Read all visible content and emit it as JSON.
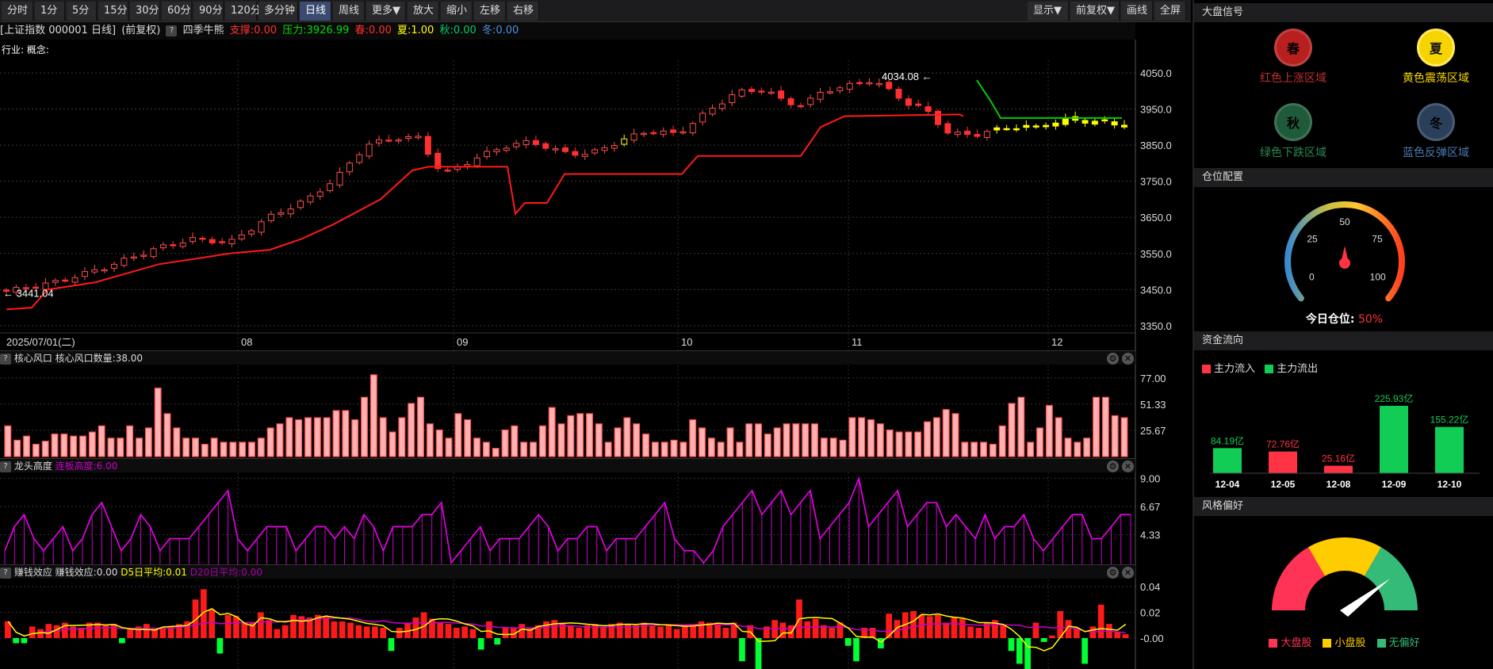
{
  "toolbar": {
    "periods": [
      "分时",
      "1分",
      "5分",
      "15分",
      "30分",
      "60分",
      "90分",
      "120分",
      "多分钟",
      "日线",
      "周线",
      "更多▼",
      "放大",
      "缩小",
      "左移",
      "右移"
    ],
    "right": [
      "显示▼",
      "前复权▼",
      "画线",
      "全屏"
    ],
    "active": "日线"
  },
  "info": {
    "symbol": "[上证指数 000001 日线]",
    "adjust": "(前复权)",
    "indicator": "四季牛熊",
    "support": "支撑:0.00",
    "pressure": "压力:3926.99",
    "spring": "春:0.00",
    "summer": "夏:1.00",
    "autumn": "秋:0.00",
    "winter": "冬:0.00"
  },
  "industry_label": "行业: 概念:",
  "main_chart": {
    "y_ticks": [
      "4050.0",
      "3950.0",
      "3850.0",
      "3750.0",
      "3650.0",
      "3550.0",
      "3450.0",
      "3350.0"
    ],
    "x_start": "2025/07/01(二)",
    "x_months": [
      "08",
      "09",
      "10",
      "11",
      "12"
    ],
    "high_label": "4034.08",
    "low_label": "3441.04",
    "colors": {
      "up": "#ff4d4d",
      "down": "#ff3030",
      "yellow": "#ffff00",
      "support": "#ff1a1a",
      "pressure": "#00cc00"
    }
  },
  "panel1": {
    "title": "核心风口",
    "value": "核心风口数量:38.00",
    "y_ticks": [
      "77.00",
      "51.33",
      "25.67"
    ],
    "values": [
      30,
      16,
      20,
      12,
      15,
      22,
      22,
      20,
      20,
      24,
      30,
      18,
      18,
      30,
      18,
      28,
      67,
      42,
      28,
      18,
      18,
      12,
      18,
      14,
      14,
      14,
      14,
      18,
      28,
      32,
      38,
      36,
      38,
      38,
      38,
      45,
      45,
      36,
      58,
      80,
      38,
      24,
      38,
      52,
      58,
      32,
      26,
      18,
      42,
      36,
      18,
      14,
      8,
      26,
      30,
      14,
      14,
      30,
      48,
      32,
      40,
      42,
      42,
      32,
      14,
      28,
      38,
      32,
      22,
      14,
      14,
      16,
      14,
      36,
      28,
      18,
      14,
      28,
      14,
      32,
      32,
      22,
      28,
      32,
      32,
      32,
      32,
      18,
      18,
      16,
      38,
      38,
      36,
      32,
      26,
      24,
      24,
      24,
      34,
      38,
      46,
      42,
      14,
      14,
      14,
      12,
      30,
      52,
      58,
      14,
      28,
      50,
      38,
      18,
      14,
      18,
      58,
      58,
      40,
      38
    ]
  },
  "panel2": {
    "title": "龙头高度",
    "value": "连板高度:6.00",
    "y_ticks": [
      "9.00",
      "6.67",
      "4.33"
    ],
    "values": [
      3,
      5,
      6,
      4,
      3,
      4,
      5,
      3,
      4,
      6,
      7,
      5,
      3,
      4,
      6,
      5,
      3,
      4,
      4,
      4,
      5,
      6,
      7,
      8,
      4,
      3,
      4,
      5,
      5,
      5,
      3,
      4,
      5,
      5,
      4,
      5,
      4,
      6,
      5,
      3,
      5,
      5,
      5,
      6,
      6,
      7,
      2,
      3,
      4,
      5,
      3,
      4,
      4,
      4,
      5,
      6,
      5,
      3,
      4,
      4,
      5,
      5,
      3,
      4,
      4,
      4,
      5,
      6,
      7,
      4,
      3,
      3,
      2,
      3,
      5,
      6,
      7,
      8,
      6,
      7,
      8,
      6,
      7,
      8,
      4,
      5,
      6,
      7,
      9,
      5,
      6,
      7,
      8,
      5,
      6,
      7,
      7,
      5,
      6,
      5,
      4,
      6,
      4,
      5,
      5,
      6,
      4,
      3,
      4,
      5,
      6,
      6,
      4,
      4,
      5,
      6,
      6
    ]
  },
  "panel3": {
    "title": "赚钱效应",
    "value": "赚钱效应:0.00",
    "d5": "D5日平均:0.01",
    "d20": "D20日平均:0.00",
    "y_ticks": [
      "0.04",
      "0.02",
      "-0.00"
    ],
    "values": [
      0.013,
      -0.004,
      -0.004,
      0.009,
      0.007,
      0.011,
      0.01,
      0.012,
      0.009,
      0.008,
      0.012,
      0.012,
      0.01,
      0.011,
      -0.004,
      0.007,
      0.009,
      0.011,
      0.008,
      0.008,
      0.009,
      0.011,
      0.013,
      0.03,
      0.038,
      0.022,
      -0.012,
      0.018,
      0.017,
      0.012,
      0.012,
      0.02,
      0.014,
      0.007,
      0.01,
      0.018,
      0.017,
      0.016,
      0.018,
      0.017,
      0.013,
      0.013,
      0.012,
      0.01,
      0.009,
      0.009,
      0.008,
      -0.01,
      0.008,
      0.012,
      0.016,
      0.02,
      0.015,
      0.012,
      0.011,
      0.008,
      0.009,
      0.007,
      -0.009,
      0.013,
      -0.005,
      0.008,
      0.008,
      0.011,
      0.008,
      0.01,
      0.013,
      0.014,
      0.012,
      0.01,
      0.008,
      0.01,
      0.011,
      0.009,
      0.011,
      0.012,
      0.011,
      0.01,
      0.012,
      0.01,
      0.009,
      0.01,
      0.007,
      0.01,
      0.011,
      0.013,
      0.012,
      0.012,
      0.008,
      0.012,
      -0.018,
      0.01,
      -0.025,
      0.009,
      0.014,
      0.012,
      0.01,
      0.03,
      0.013,
      0.015,
      0.01,
      0.008,
      0.012,
      -0.006,
      -0.018,
      0.008,
      0.008,
      -0.008,
      0.019,
      0.014,
      0.02,
      0.021,
      0.018,
      0.017,
      0.018,
      0.012,
      0.016,
      0.015,
      0.009,
      0.008,
      0.012,
      0.014,
      0.01,
      -0.01,
      -0.02,
      -0.028,
      0.012,
      -0.003,
      0.002,
      0.021,
      0.014,
      0.008,
      -0.02,
      0.009,
      0.026,
      0.011,
      0.005,
      0.003
    ],
    "colors": {
      "up": "#ff1a1a",
      "down": "#00ff33",
      "d5": "#ffff00",
      "d20": "#cc00cc"
    }
  },
  "sidebar": {
    "signal": {
      "title": "大盘信号",
      "items": [
        {
          "badge": "春",
          "label": "红色上涨区域",
          "color": "#b82020",
          "text_color": "#c03030"
        },
        {
          "badge": "夏",
          "label": "黄色震荡区域",
          "color": "#f5d400",
          "text_color": "#f5d400"
        },
        {
          "badge": "秋",
          "label": "绿色下跌区域",
          "color": "#1f5a3a",
          "text_color": "#2a8a50"
        },
        {
          "badge": "冬",
          "label": "蓝色反弹区域",
          "color": "#2a3f5a",
          "text_color": "#4a7ab0"
        }
      ]
    },
    "position": {
      "title": "仓位配置",
      "ticks": [
        "0",
        "25",
        "50",
        "75",
        "100"
      ],
      "label": "今日仓位:",
      "value": "50%",
      "level": 0.5
    },
    "flow": {
      "title": "资金流向",
      "legend_in": "主力流入",
      "legend_out": "主力流出",
      "bars": [
        {
          "date": "12-04",
          "label": "84.19亿",
          "value": 84.19,
          "type": "out"
        },
        {
          "date": "12-05",
          "label": "72.76亿",
          "value": 72.76,
          "type": "in"
        },
        {
          "date": "12-08",
          "label": "25.16亿",
          "value": 25.16,
          "type": "in"
        },
        {
          "date": "12-09",
          "label": "225.93亿",
          "value": 225.93,
          "type": "out"
        },
        {
          "date": "12-10",
          "label": "155.22亿",
          "value": 155.22,
          "type": "out"
        }
      ],
      "colors": {
        "in": "#ff3344",
        "out": "#11cc55"
      }
    },
    "style": {
      "title": "风格偏好",
      "legend": [
        {
          "label": "大盘股",
          "color": "#ff3355"
        },
        {
          "label": "小盘股",
          "color": "#ffcc00"
        },
        {
          "label": "无偏好",
          "color": "#33bb77"
        }
      ]
    }
  }
}
